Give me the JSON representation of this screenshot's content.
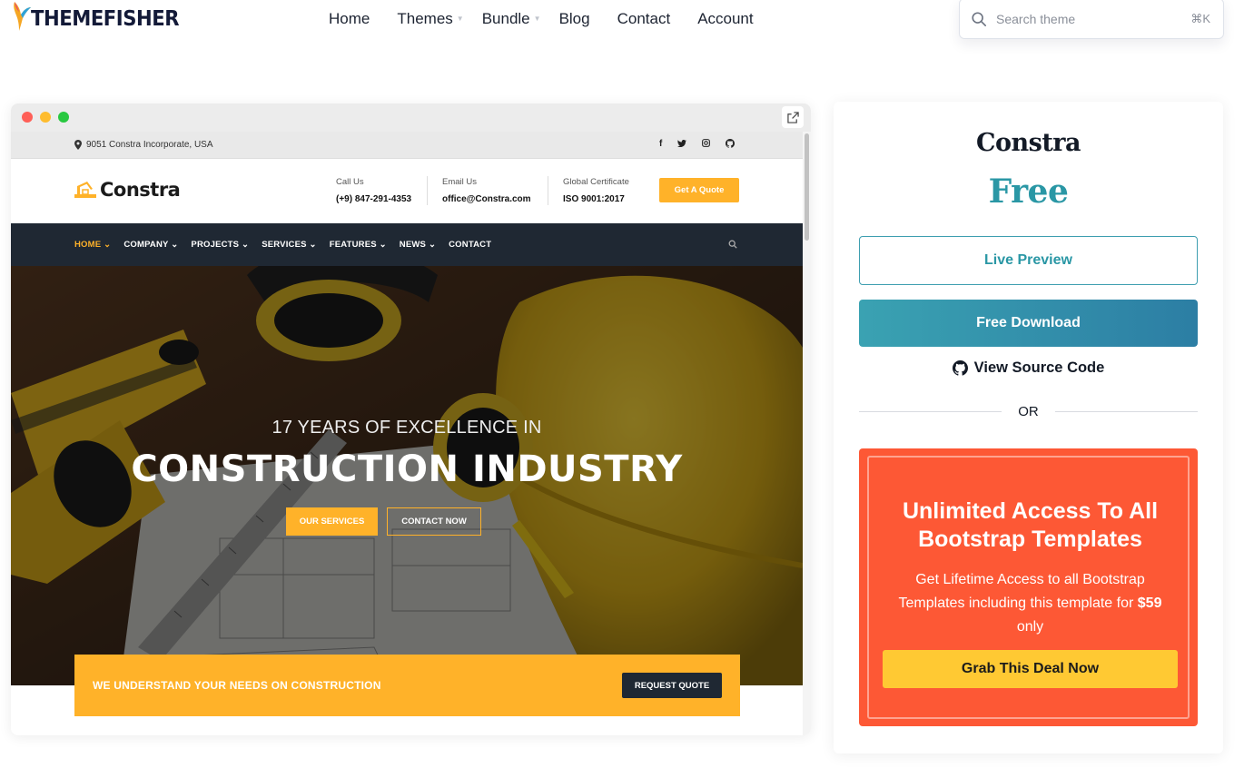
{
  "header": {
    "brand": "THEMEFISHER",
    "nav": [
      {
        "label": "Home",
        "has_caret": false
      },
      {
        "label": "Themes",
        "has_caret": true
      },
      {
        "label": "Bundle",
        "has_caret": true
      },
      {
        "label": "Blog",
        "has_caret": false
      },
      {
        "label": "Contact",
        "has_caret": false
      },
      {
        "label": "Account",
        "has_caret": false
      }
    ],
    "search": {
      "placeholder": "Search theme",
      "shortcut": "⌘K"
    }
  },
  "preview": {
    "topbar": {
      "address": "9051 Constra Incorporate, USA",
      "social_icons": [
        "facebook-icon",
        "twitter-icon",
        "instagram-icon",
        "github-icon"
      ]
    },
    "site_header": {
      "logo_text": "Constra",
      "info": [
        {
          "label": "Call Us",
          "value": "(+9) 847-291-4353"
        },
        {
          "label": "Email Us",
          "value": "office@Constra.com"
        },
        {
          "label": "Global Certificate",
          "value": "ISO 9001:2017"
        }
      ],
      "quote_button": "Get A Quote"
    },
    "site_nav": {
      "items": [
        "HOME",
        "COMPANY",
        "PROJECTS",
        "SERVICES",
        "FEATURES",
        "NEWS",
        "CONTACT"
      ],
      "active_index": 0,
      "dropdown_items": [
        0,
        1,
        2,
        3,
        4,
        5
      ]
    },
    "hero": {
      "subtitle": "17 YEARS OF EXCELLENCE IN",
      "title": "CONSTRUCTION INDUSTRY",
      "primary_button": "OUR SERVICES",
      "secondary_button": "CONTACT NOW"
    },
    "strip": {
      "text": "WE UNDERSTAND YOUR NEEDS ON CONSTRUCTION",
      "button": "REQUEST QUOTE"
    }
  },
  "panel": {
    "title": "Constra",
    "price": "Free",
    "live_preview": "Live Preview",
    "download": "Free Download",
    "source_code": "View Source Code",
    "or": "OR",
    "promo": {
      "title": "Unlimited Access To All Bootstrap Templates",
      "desc_before": "Get Lifetime Access to all Bootstrap Templates including this template for",
      "price": "$59",
      "desc_after": "only",
      "button": "Grab This Deal Now"
    }
  },
  "colors": {
    "accent_teal": "#2a97a5",
    "promo_red": "#fd5835",
    "promo_button": "#ffc933",
    "constra_orange": "#ffb229",
    "constra_dark": "#1f2833"
  }
}
